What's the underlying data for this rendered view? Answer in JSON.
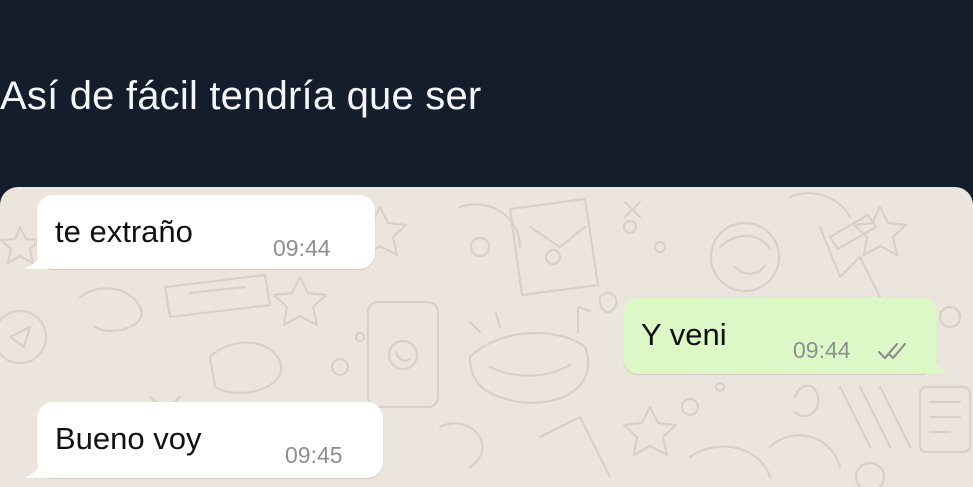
{
  "post": {
    "caption": "Así de fácil tendría que ser"
  },
  "messages": [
    {
      "direction": "incoming",
      "text": "te extraño",
      "time": "09:44"
    },
    {
      "direction": "outgoing",
      "text": "Y veni",
      "time": "09:44",
      "status_icon": "double-check-icon"
    },
    {
      "direction": "incoming",
      "text": "Bueno voy",
      "time": "09:45"
    }
  ],
  "colors": {
    "page_background": "#141d2b",
    "chat_background": "#ece5dd",
    "incoming_bubble": "#ffffff",
    "outgoing_bubble": "#dcf8c6",
    "timestamp": "#8c8f93",
    "caption_text": "#f4f5f7"
  }
}
